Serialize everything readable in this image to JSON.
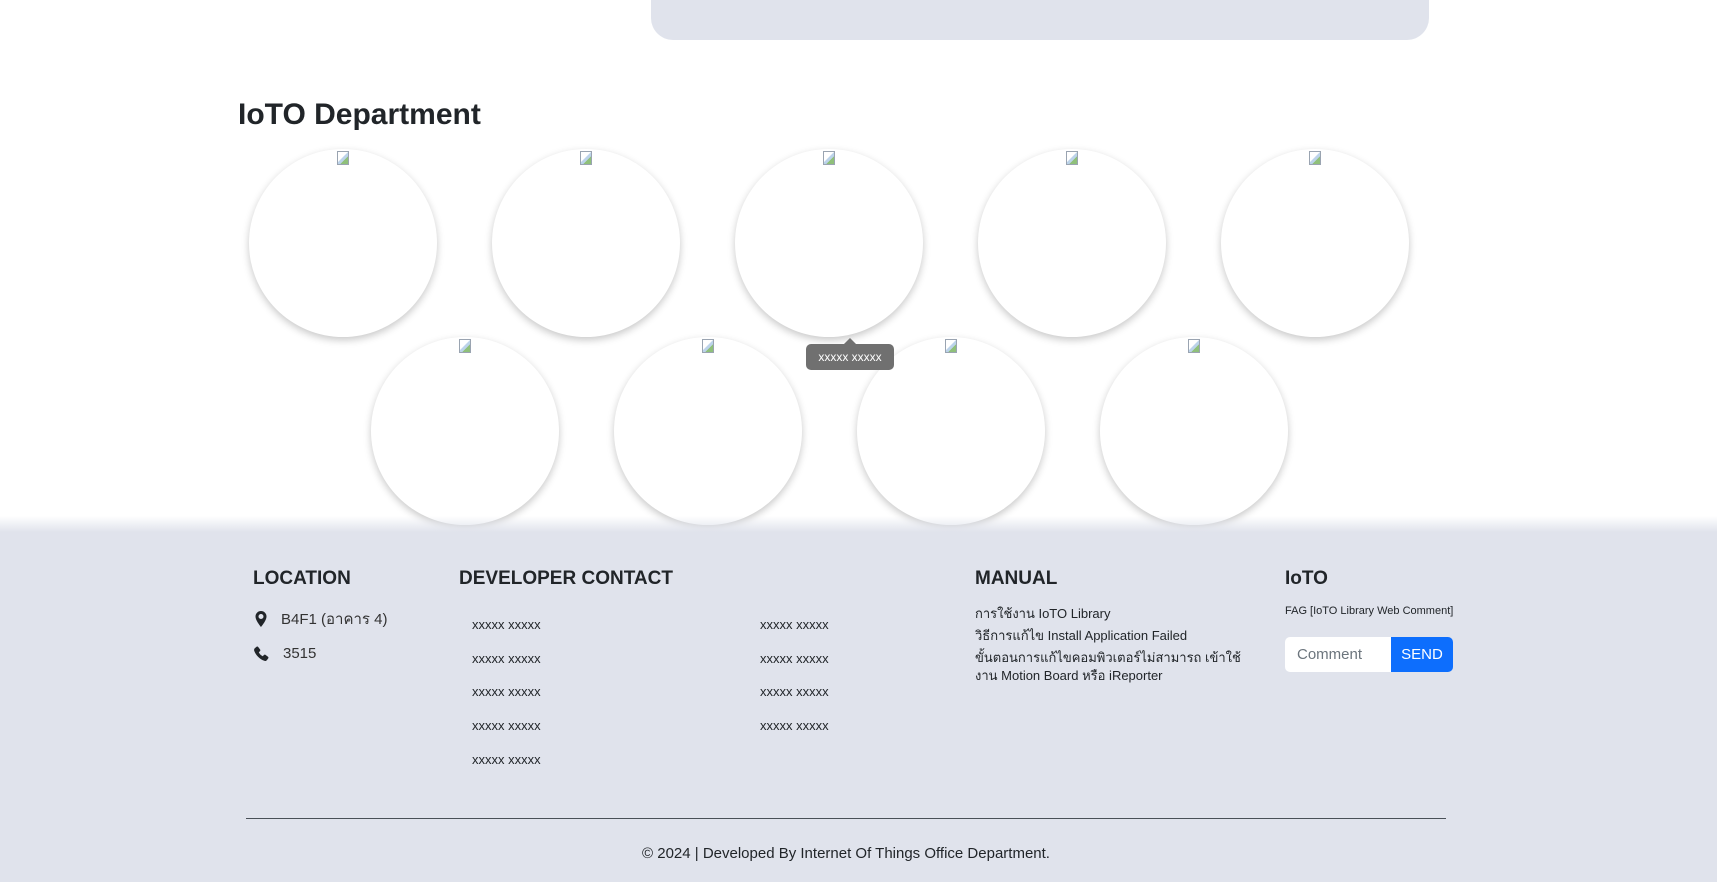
{
  "department": {
    "title": "IoTO Department",
    "members_row1": [
      "",
      "",
      "",
      "",
      ""
    ],
    "members_row2": [
      "",
      "",
      "",
      ""
    ],
    "tooltip": "xxxxx xxxxx"
  },
  "footer": {
    "location": {
      "heading": "LOCATION",
      "place_icon": "map-pin-icon",
      "place": "B4F1 (อาคาร 4)",
      "phone_icon": "phone-icon",
      "phone": "3515"
    },
    "developer_contact": {
      "heading": "DEVELOPER CONTACT",
      "column1": [
        "xxxxx xxxxx",
        "xxxxx xxxxx",
        "xxxxx xxxxx",
        "xxxxx xxxxx",
        "xxxxx xxxxx"
      ],
      "column2": [
        "xxxxx xxxxx",
        "xxxxx xxxxx",
        "xxxxx xxxxx",
        "xxxxx xxxxx"
      ]
    },
    "manual": {
      "heading": "MANUAL",
      "links": [
        "การใช้งาน IoTO Library",
        "วิธีการแก้ไข Install Application Failed",
        "ขั้นตอนการแก้ไขคอมพิวเตอร์ไม่สามารถ เข้าใช้งาน Motion Board หรือ iReporter"
      ]
    },
    "ioto": {
      "heading": "IoTO",
      "fag_text": "FAG [IoTO Library Web Comment]",
      "comment_placeholder": "Comment",
      "send_label": "SEND",
      "send_color": "#0d6efd"
    },
    "copyright": "© 2024 | Developed By Internet Of Things Office Department."
  }
}
